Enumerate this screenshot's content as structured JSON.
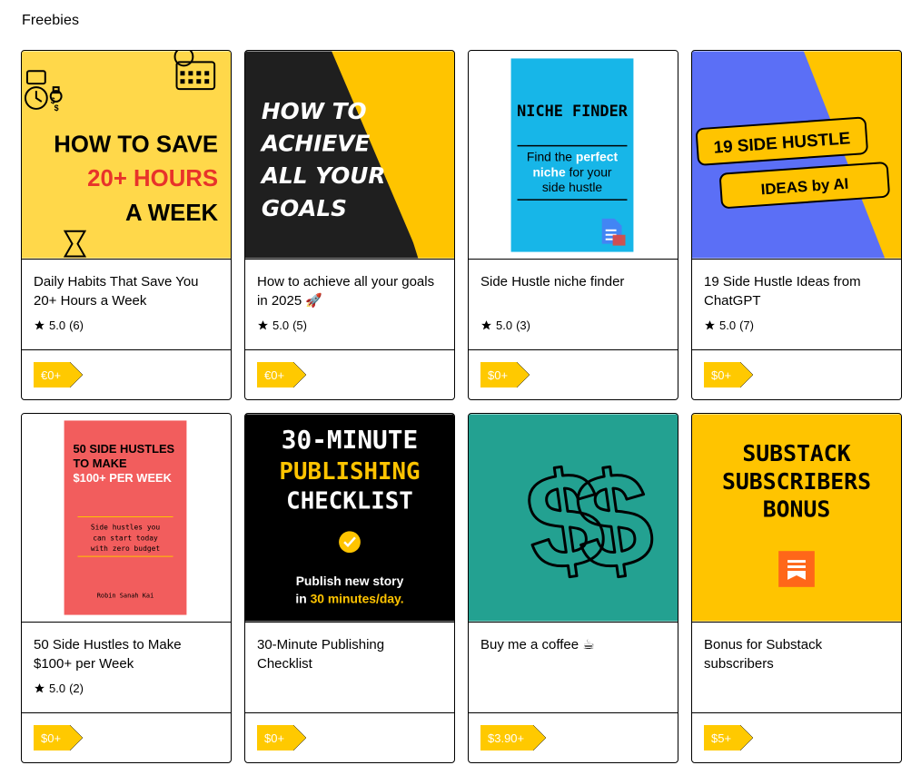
{
  "section": {
    "title": "Freebies"
  },
  "products": [
    {
      "name": "Daily Habits That Save You 20+ Hours a Week",
      "rating": "5.0",
      "count": "(6)",
      "price": "€0+",
      "cover": {
        "line1": "HOW TO SAVE",
        "line2": "20+ HOURS",
        "line3": "A WEEK"
      }
    },
    {
      "name": "How to achieve all your goals in 2025 🚀",
      "rating": "5.0",
      "count": "(5)",
      "price": "€0+",
      "cover": {
        "line1": "HOW TO",
        "line2": "ACHIEVE",
        "line3": "ALL YOUR",
        "line4": "GOALS"
      }
    },
    {
      "name": "Side Hustle niche finder",
      "rating": "5.0",
      "count": "(3)",
      "price": "$0+",
      "cover": {
        "title": "NICHE FINDER",
        "line1": "Find the",
        "hl1": "perfect",
        "hl2": "niche",
        "line2": "for your",
        "line3": "side hustle"
      }
    },
    {
      "name": "19 Side Hustle Ideas from ChatGPT",
      "rating": "5.0",
      "count": "(7)",
      "price": "$0+",
      "cover": {
        "line1": "19 SIDE HUSTLE",
        "line2": "IDEAS by AI"
      }
    },
    {
      "name": "50 Side Hustles to Make $100+ per Week",
      "rating": "5.0",
      "count": "(2)",
      "price": "$0+",
      "cover": {
        "line1": "50 SIDE HUSTLES",
        "line2": "TO MAKE",
        "line3": "$100+ PER WEEK",
        "sub1": "Side hustles you",
        "sub2": "can start today",
        "sub3": "with zero budget",
        "author": "Robin Sanah Kai"
      }
    },
    {
      "name": "30-Minute Publishing Checklist",
      "rating": "",
      "count": "",
      "price": "$0+",
      "cover": {
        "line1": "30-MINUTE",
        "line2": "PUBLISHING",
        "line3": "CHECKLIST",
        "sub1": "Publish new story",
        "sub2a": "in ",
        "sub2b": "30 minutes/day."
      }
    },
    {
      "name": "Buy me a coffee ☕",
      "rating": "",
      "count": "",
      "price": "$3.90+",
      "cover": {}
    },
    {
      "name": "Bonus for Substack subscribers",
      "rating": "",
      "count": "",
      "price": "$5+",
      "cover": {
        "line1": "SUBSTACK",
        "line2": "SUBSCRIBERS",
        "line3": "BONUS"
      }
    }
  ],
  "colors": {
    "accent": "#ffc900",
    "border": "#000000",
    "blue": "#5b6ff6",
    "cyan": "#17b6e8",
    "coral": "#f25d5d",
    "teal": "#23a191",
    "orange": "#ff6719"
  }
}
